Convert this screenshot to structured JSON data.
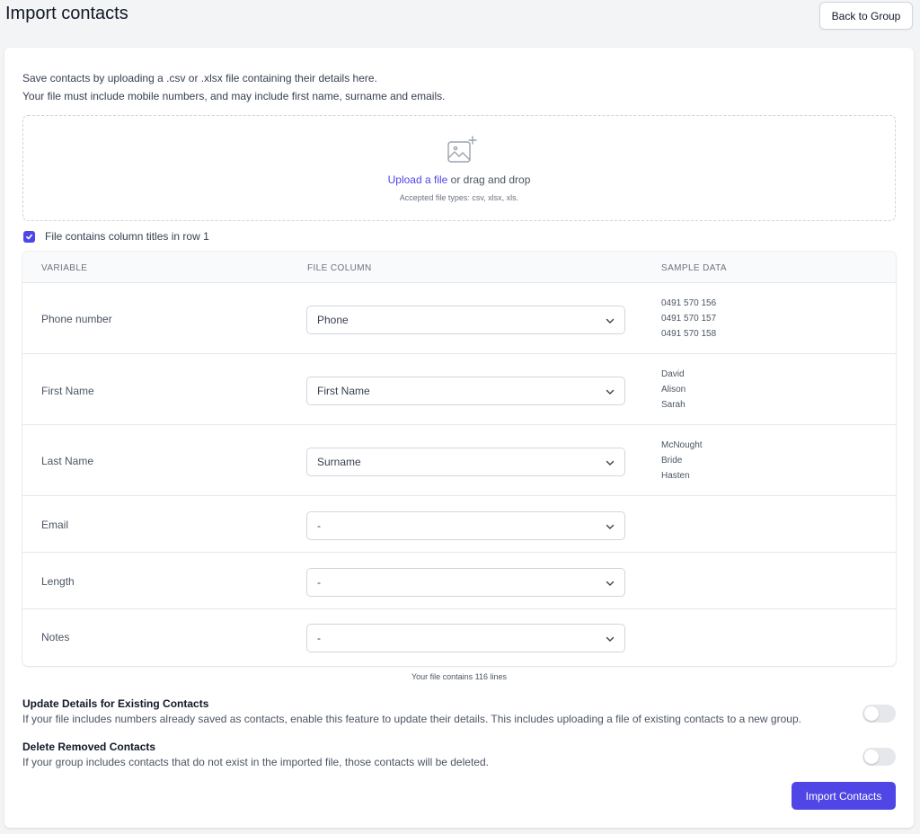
{
  "header": {
    "title": "Import contacts",
    "back_label": "Back to Group"
  },
  "intro": {
    "line1": "Save contacts by uploading a .csv or .xlsx file containing their details here.",
    "line2": "Your file must include mobile numbers, and may include first name, surname and emails."
  },
  "dropzone": {
    "upload_link": "Upload a file",
    "or_text": " or drag and drop",
    "accepted": "Accepted file types: csv, xlsx, xls."
  },
  "column_titles_checkbox": {
    "label": "File contains column titles in row 1",
    "checked": true
  },
  "table": {
    "headers": [
      "VARIABLE",
      "FILE COLUMN",
      "SAMPLE DATA"
    ],
    "rows": [
      {
        "variable": "Phone number",
        "column": "Phone",
        "samples": [
          "0491 570 156",
          "0491 570 157",
          "0491 570 158"
        ]
      },
      {
        "variable": "First Name",
        "column": "First Name",
        "samples": [
          "David",
          "Alison",
          "Sarah"
        ]
      },
      {
        "variable": "Last Name",
        "column": "Surname",
        "samples": [
          "McNought",
          "Bride",
          "Hasten"
        ]
      },
      {
        "variable": "Email",
        "column": "-",
        "samples": []
      },
      {
        "variable": "Length",
        "column": "-",
        "samples": []
      },
      {
        "variable": "Notes",
        "column": "-",
        "samples": []
      }
    ]
  },
  "lines_note": "Your file contains 116 lines",
  "settings": [
    {
      "title": "Update Details for Existing Contacts",
      "description": "If your file includes numbers already saved as contacts, enable this feature to update their details. This includes uploading a file of existing contacts to a new group.",
      "enabled": false
    },
    {
      "title": "Delete Removed Contacts",
      "description": "If your group includes contacts that do not exist in the imported file, those contacts will be deleted.",
      "enabled": false
    }
  ],
  "import_button": "Import Contacts",
  "colors": {
    "accent": "#4f46e5",
    "background": "#f3f4f6",
    "toggle_off": "#e5e7eb"
  },
  "icons": {
    "upload": "image-plus-icon",
    "select": "chevron-down-icon",
    "checkbox": "check-icon"
  }
}
